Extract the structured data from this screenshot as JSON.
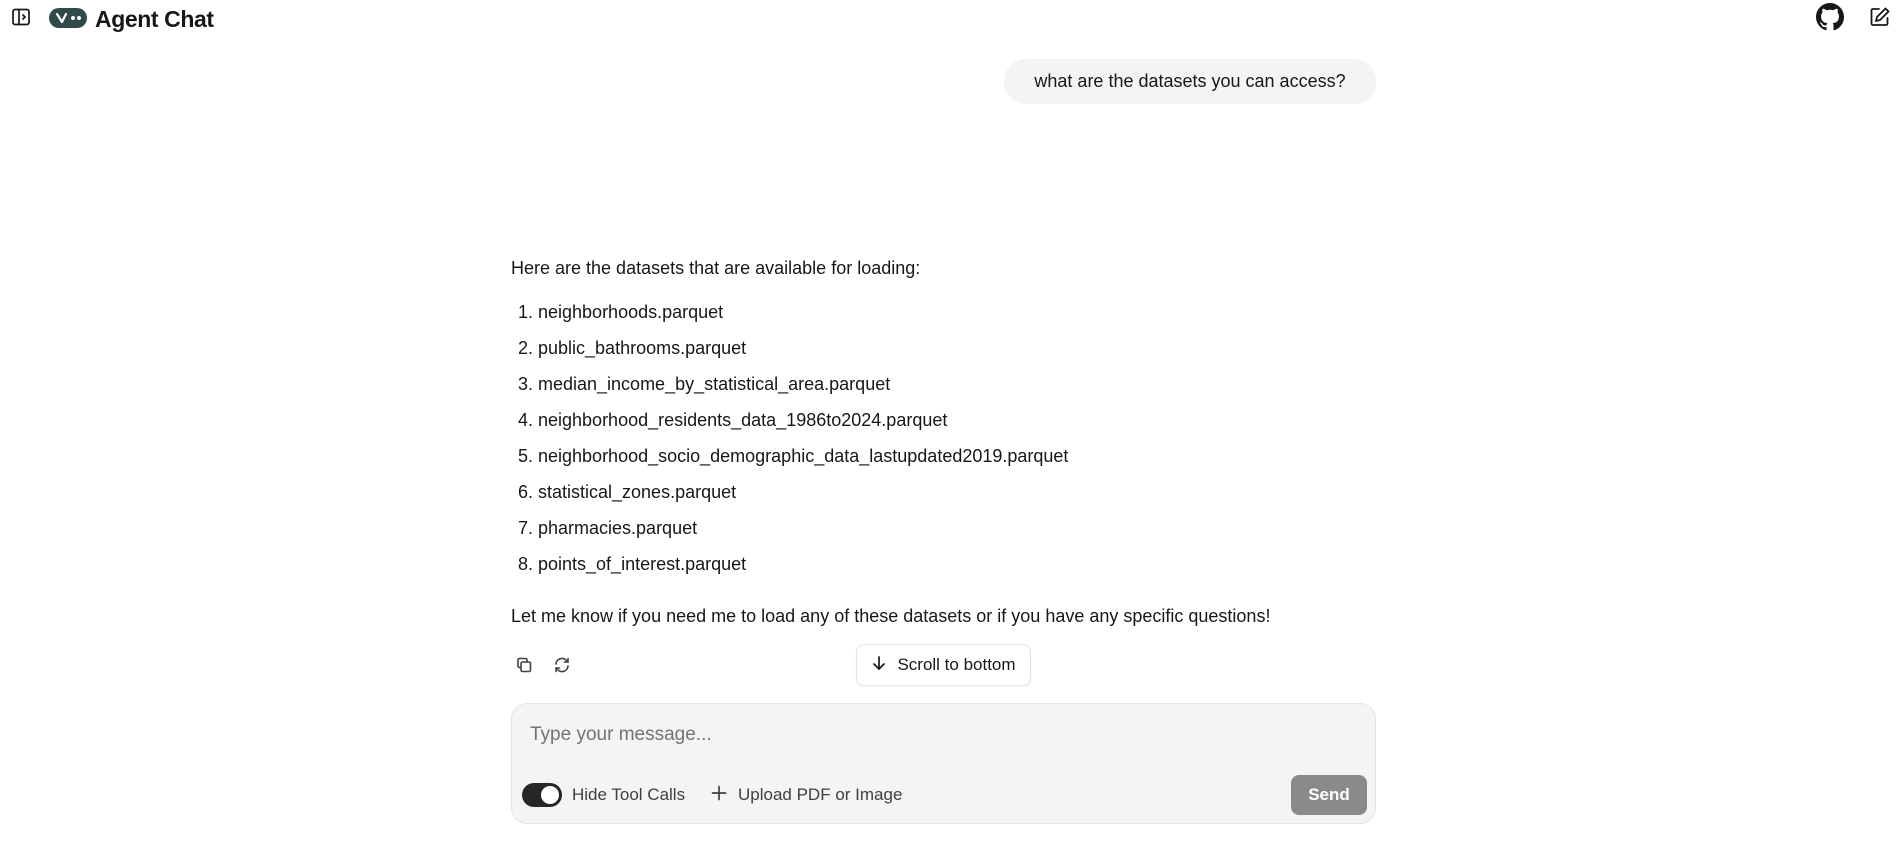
{
  "header": {
    "title": "Agent Chat",
    "icons": {
      "sidebar_toggle": "sidebar-toggle-icon",
      "logo": "logo-icon",
      "github": "github-icon",
      "new_chat": "new-chat-icon"
    }
  },
  "conversation": {
    "user_message": "what are the datasets you can access?",
    "assistant": {
      "intro": "Here are the datasets that are available for loading:",
      "datasets": [
        "neighborhoods.parquet",
        "public_bathrooms.parquet",
        "median_income_by_statistical_area.parquet",
        "neighborhood_residents_data_1986to2024.parquet",
        "neighborhood_socio_demographic_data_lastupdated2019.parquet",
        "statistical_zones.parquet",
        "pharmacies.parquet",
        "points_of_interest.parquet"
      ],
      "outro": "Let me know if you need me to load any of these datasets or if you have any specific questions!"
    },
    "actions": {
      "copy_icon": "copy-icon",
      "regenerate_icon": "regenerate-icon"
    },
    "scroll_to_bottom_label": "Scroll to bottom"
  },
  "composer": {
    "placeholder": "Type your message...",
    "value": "",
    "hide_tool_calls_label": "Hide Tool Calls",
    "hide_tool_calls_on": true,
    "upload_label": "Upload PDF or Image",
    "send_label": "Send"
  },
  "colors": {
    "toggle_on": "#262626",
    "send_disabled": "#8a8a8a",
    "bubble_bg": "#f4f4f5"
  }
}
